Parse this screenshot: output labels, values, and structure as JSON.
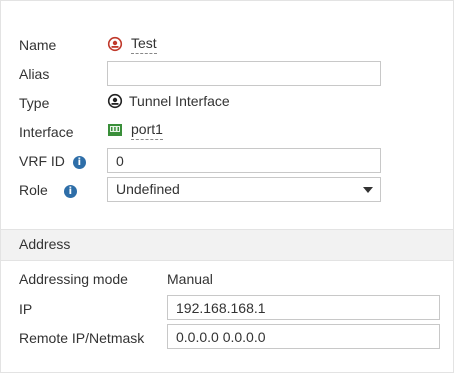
{
  "form": {
    "name": {
      "label": "Name",
      "value": "Test",
      "icon": "tunnel-interface-icon"
    },
    "alias": {
      "label": "Alias",
      "value": ""
    },
    "type": {
      "label": "Type",
      "value": "Tunnel Interface",
      "icon": "tunnel-interface-icon"
    },
    "interface": {
      "label": "Interface",
      "value": "port1",
      "icon": "port-icon"
    },
    "vrf_id": {
      "label": "VRF ID",
      "value": "0",
      "info_icon": "info-icon"
    },
    "role": {
      "label": "Role",
      "value": "Undefined",
      "info_icon": "info-icon"
    }
  },
  "address": {
    "section_title": "Address",
    "addressing_mode": {
      "label": "Addressing mode",
      "value": "Manual"
    },
    "ip": {
      "label": "IP",
      "value": "192.168.168.1"
    },
    "remote_ip": {
      "label": "Remote IP/Netmask",
      "value": "0.0.0.0 0.0.0.0"
    }
  },
  "colors": {
    "tunnel_icon_red": "#c0392b",
    "port_icon_green": "#3a8f3a",
    "info_blue": "#2e6ea8",
    "section_bg": "#f2f2f2"
  }
}
